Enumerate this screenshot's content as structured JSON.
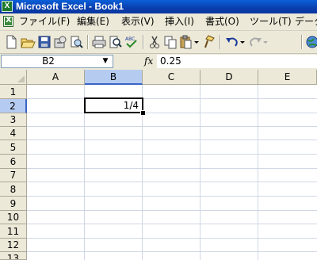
{
  "window": {
    "title": "Microsoft Excel - Book1"
  },
  "menu": {
    "items": [
      "ファイル(F)",
      "編集(E)",
      "表示(V)",
      "挿入(I)",
      "書式(O)",
      "ツール(T)",
      "データ"
    ]
  },
  "toolbar": {
    "buttons": [
      "new-icon",
      "open-icon",
      "save-icon",
      "permission-icon",
      "print-preview-icon",
      "print-icon",
      "preview-icon",
      "spelling-icon",
      "cut-icon",
      "copy-icon",
      "paste-icon",
      "format-painter-icon",
      "undo-icon",
      "redo-icon",
      "hyperlink-icon"
    ]
  },
  "formula_bar": {
    "name_box": "B2",
    "fx_label": "fx",
    "value": "0.25"
  },
  "grid": {
    "columns": [
      "A",
      "B",
      "C",
      "D",
      "E"
    ],
    "rows": [
      "1",
      "2",
      "3",
      "4",
      "5",
      "6",
      "7",
      "8",
      "9",
      "10",
      "11",
      "12",
      "13"
    ],
    "selected_column": "B",
    "selected_row": "2",
    "cells": {
      "B2": "1/4"
    }
  },
  "colors": {
    "title_bar": "#0a3fae",
    "chrome": "#ece9d8",
    "selection_header": "#b6cbf0",
    "gridline": "#d0d7e5"
  }
}
